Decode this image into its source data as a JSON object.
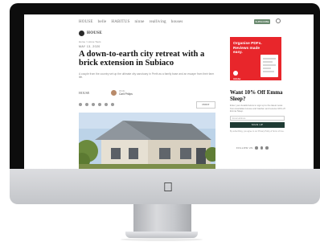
{
  "site": {
    "brands": [
      "HOUSE",
      "belle",
      "HABITUS",
      "ninne",
      "realliving",
      "houses"
    ],
    "logo": "HOUSE",
    "subscribe_label": "SUBSCRIBE"
  },
  "article": {
    "breadcrumb": "Home  >  Home Tours",
    "date": "MAY 13, 2020",
    "headline": "A down-to-earth city retreat with a brick extension in Subiaco",
    "standfirst": "A couple from the country set up the ultimate city sanctuary in Perth as a family base and an escape from their farm life.",
    "author_logo": "HOUSE",
    "author_label": "Words",
    "author_name": "Carli Philips",
    "print_label": "PRINT"
  },
  "ad": {
    "title": "Organise PDFs. Reviews made easy.",
    "brand": "Adobe"
  },
  "promo": {
    "title": "Want 10% Off Emma Sleep?",
    "copy": "Enter your details below to sign up to the latest news from Australian House and Garden and receive 10% off Emma Sleep.",
    "email_placeholder": "Email address",
    "signup_label": "SIGN UP",
    "fine_print": "By subscribing, you agree to our Privacy Policy & Terms of Use.",
    "follow_label": "FOLLOW US"
  }
}
